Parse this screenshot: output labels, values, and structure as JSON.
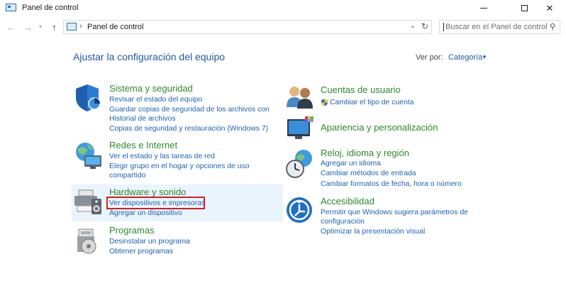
{
  "window": {
    "title": "Panel de control"
  },
  "address": {
    "path": "Panel de control",
    "search_placeholder": "Buscar en el Panel de control"
  },
  "header": {
    "title": "Ajustar la configuración del equipo",
    "view_by_label": "Ver por:",
    "view_by_value": "Categoría"
  },
  "categories": [
    {
      "title": "Sistema y seguridad",
      "icon": "security-shield-icon",
      "links": [
        "Revisar el estado del equipo",
        "Guardar copias de seguridad de los archivos con Historial de archivos",
        "Copias de seguridad y restauración (Windows 7)"
      ]
    },
    {
      "title": "Redes e Internet",
      "icon": "network-globe-icon",
      "links": [
        "Ver el estado y las tareas de red",
        "Elegir grupo en el hogar y opciones de uso compartido"
      ]
    },
    {
      "title": "Hardware y sonido",
      "icon": "printer-speaker-icon",
      "links": [
        "Ver dispositivos e impresoras",
        "Agregar un dispositivo"
      ]
    },
    {
      "title": "Programas",
      "icon": "programs-disc-icon",
      "links": [
        "Desinstalar un programa",
        "Obtener programas"
      ]
    },
    {
      "title": "Cuentas de usuario",
      "icon": "users-icon",
      "links": [
        "Cambiar el tipo de cuenta"
      ]
    },
    {
      "title": "Apariencia y personalización",
      "icon": "monitor-palette-icon",
      "links": []
    },
    {
      "title": "Reloj, idioma y región",
      "icon": "clock-globe-icon",
      "links": [
        "Agregar un idioma",
        "Cambiar métodos de entrada",
        "Cambiar formatos de fecha, hora o número"
      ]
    },
    {
      "title": "Accesibilidad",
      "icon": "accessibility-icon",
      "links": [
        "Permitir que Windows sugiera parámetros de configuración",
        "Optimizar la presentación visual"
      ]
    }
  ],
  "colors": {
    "link": "#1c62b3",
    "category_title": "#2a8a2a",
    "highlight": "#eaf4fd",
    "annotation": "#d21f1f"
  }
}
